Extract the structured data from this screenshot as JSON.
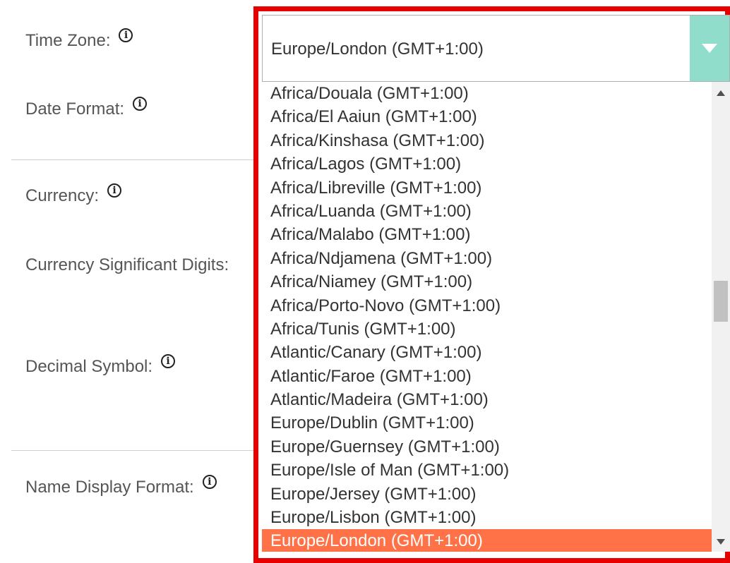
{
  "labels": {
    "time_zone": "Time Zone:",
    "date_format": "Date Format:",
    "currency": "Currency:",
    "currency_digits": "Currency Significant Digits:",
    "decimal_symbol": "Decimal Symbol:",
    "name_display_format": "Name Display Format:"
  },
  "info_glyph": "i",
  "time_zone_select": {
    "value": "Europe/London (GMT+1:00)",
    "accent_color": "#8fddca",
    "options": [
      "Africa/Douala (GMT+1:00)",
      "Africa/El Aaiun (GMT+1:00)",
      "Africa/Kinshasa (GMT+1:00)",
      "Africa/Lagos (GMT+1:00)",
      "Africa/Libreville (GMT+1:00)",
      "Africa/Luanda (GMT+1:00)",
      "Africa/Malabo (GMT+1:00)",
      "Africa/Ndjamena (GMT+1:00)",
      "Africa/Niamey (GMT+1:00)",
      "Africa/Porto-Novo (GMT+1:00)",
      "Africa/Tunis (GMT+1:00)",
      "Atlantic/Canary (GMT+1:00)",
      "Atlantic/Faroe (GMT+1:00)",
      "Atlantic/Madeira (GMT+1:00)",
      "Europe/Dublin (GMT+1:00)",
      "Europe/Guernsey (GMT+1:00)",
      "Europe/Isle of Man (GMT+1:00)",
      "Europe/Jersey (GMT+1:00)",
      "Europe/Lisbon (GMT+1:00)",
      "Europe/London (GMT+1:00)"
    ],
    "selected_index": 19,
    "highlight_color": "#ff7248",
    "frame_color": "#e60000"
  }
}
